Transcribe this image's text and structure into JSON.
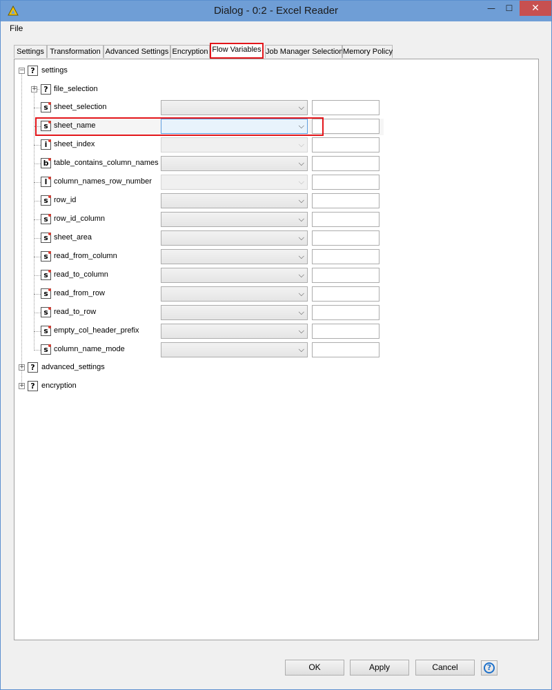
{
  "window": {
    "title": "Dialog - 0:2 - Excel Reader",
    "minimize_glyph": "—",
    "maximize_glyph": "☐",
    "close_glyph": "✕"
  },
  "menubar": {
    "file": "File"
  },
  "tabs": [
    {
      "label": "Settings"
    },
    {
      "label": "Transformation"
    },
    {
      "label": "Advanced Settings"
    },
    {
      "label": "Encryption"
    },
    {
      "label": "Flow Variables",
      "active": true
    },
    {
      "label": "Job Manager Selection"
    },
    {
      "label": "Memory Policy"
    }
  ],
  "tree": {
    "root_label": "settings",
    "file_selection": "file_selection",
    "rows": [
      {
        "type": "s",
        "label": "sheet_selection",
        "enabled": true
      },
      {
        "type": "s",
        "label": "sheet_name",
        "enabled": true,
        "focused": true
      },
      {
        "type": "i",
        "label": "sheet_index",
        "enabled": false
      },
      {
        "type": "b",
        "label": "table_contains_column_names",
        "enabled": true
      },
      {
        "type": "l",
        "label": "column_names_row_number",
        "enabled": false
      },
      {
        "type": "s",
        "label": "row_id",
        "enabled": true
      },
      {
        "type": "s",
        "label": "row_id_column",
        "enabled": true
      },
      {
        "type": "s",
        "label": "sheet_area",
        "enabled": true
      },
      {
        "type": "s",
        "label": "read_from_column",
        "enabled": true
      },
      {
        "type": "s",
        "label": "read_to_column",
        "enabled": true
      },
      {
        "type": "s",
        "label": "read_from_row",
        "enabled": true
      },
      {
        "type": "s",
        "label": "read_to_row",
        "enabled": true
      },
      {
        "type": "s",
        "label": "empty_col_header_prefix",
        "enabled": true
      },
      {
        "type": "s",
        "label": "column_name_mode",
        "enabled": true
      }
    ],
    "advanced_settings": "advanced_settings",
    "encryption": "encryption",
    "unknown_glyph": "?"
  },
  "buttons": {
    "ok": "OK",
    "apply": "Apply",
    "cancel": "Cancel",
    "help_glyph": "?"
  },
  "colors": {
    "highlight": "#e3151a",
    "titlebar": "#6f9ed6",
    "close": "#c75050"
  }
}
